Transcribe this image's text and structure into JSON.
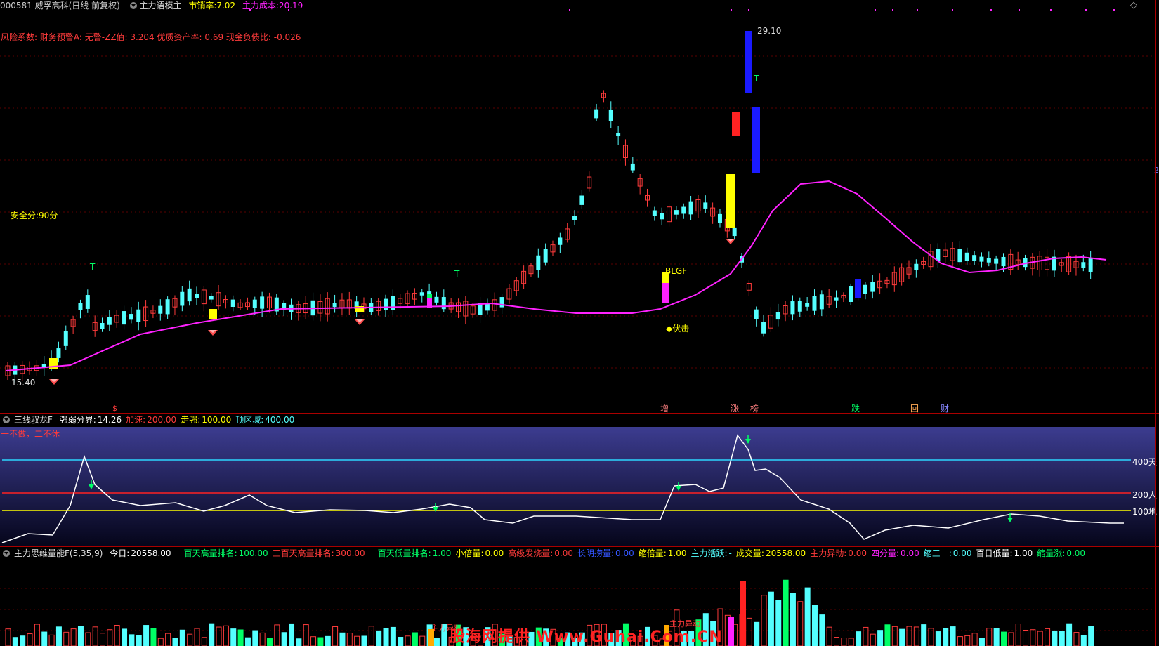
{
  "colors": {
    "up": "#ff3b3b",
    "down": "#54ffff",
    "ma": "#ff22ff",
    "label_red": "#ff3b3b",
    "label_yellow": "#ffff00",
    "label_cyan": "#54ffff",
    "label_green": "#00ff66",
    "label_magenta": "#ff22ff"
  },
  "header": {
    "code_name": "000581 威孚高科(日线 前复权)",
    "indicator": "主力语模主",
    "pe_label": "市销率:",
    "pe_value": "7.02",
    "cost_label": "主力成本:",
    "cost_value": "20.19"
  },
  "risk_line": "风险系数: 财务预警A: 无警-ZZ值: 3.204 优质资产率: 0.69 现金负债比: -0.026",
  "safety_score": "安全分:90分",
  "price_labels": {
    "high": "29.10",
    "low": "15.40"
  },
  "annotations": {
    "t_mark": "T",
    "blgf": "BLGF",
    "fuji": "◆伏击",
    "s_mark": "$"
  },
  "bottom_tags": [
    "增",
    "涨",
    "榜",
    "跌",
    "回",
    "财"
  ],
  "panel2": {
    "name": "三线驭龙F",
    "items": [
      {
        "label": "强弱分界:",
        "value": "14.26",
        "color": "#ffffff"
      },
      {
        "label": "加速:",
        "value": "200.00",
        "color": "#ff3b3b"
      },
      {
        "label": "走强:",
        "value": "100.00",
        "color": "#ffff00"
      },
      {
        "label": "顶区域:",
        "value": "400.00",
        "color": "#54ffff"
      }
    ],
    "slogan": "一不做，二不休",
    "levels": [
      {
        "label": "400天",
        "value": 400
      },
      {
        "label": "200人",
        "value": 200
      },
      {
        "label": "100地",
        "value": 100
      }
    ]
  },
  "panel3": {
    "name": "主力思维量能F(5,35,9)",
    "items": [
      {
        "label": "今日:",
        "value": "20558.00",
        "color": "#ffffff"
      },
      {
        "label": "一百天高量排名:",
        "value": "100.00",
        "color": "#00ff66"
      },
      {
        "label": "三百天高量排名:",
        "value": "300.00",
        "color": "#ff3b3b"
      },
      {
        "label": "一百天低量排名:",
        "value": "1.00",
        "color": "#00ff66"
      },
      {
        "label": "小倍量:",
        "value": "0.00",
        "color": "#ffff00"
      },
      {
        "label": "高级发烧量:",
        "value": "0.00",
        "color": "#ff3b3b"
      },
      {
        "label": "长阴捞量:",
        "value": "0.00",
        "color": "#3355ff"
      },
      {
        "label": "缩倍量:",
        "value": "1.00",
        "color": "#ffff00"
      },
      {
        "label": "主力活跃:",
        "value": "-",
        "color": "#54ffff"
      },
      {
        "label": "成交量:",
        "value": "20558.00",
        "color": "#ffff00"
      },
      {
        "label": "主力异动:",
        "value": "0.00",
        "color": "#ff3b3b"
      },
      {
        "label": "四分量:",
        "value": "0.00",
        "color": "#ff22ff"
      },
      {
        "label": "缩三一:",
        "value": "0.00",
        "color": "#54ffff"
      },
      {
        "label": "百日低量:",
        "value": "1.00",
        "color": "#ffffff"
      },
      {
        "label": "缩量涨:",
        "value": "0.00",
        "color": "#00ff66"
      }
    ],
    "tags": [
      "主力异动",
      "主力异动"
    ]
  },
  "watermark": "股海网提供 Www.Guhai.Com.CN",
  "right_edge_mark": "2"
}
